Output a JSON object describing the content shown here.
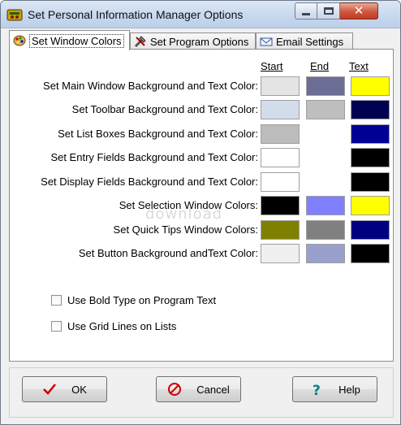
{
  "window": {
    "title": "Set Personal Information Manager Options",
    "controls": {
      "minimize": "minimize",
      "maximize": "maximize",
      "close": "close"
    }
  },
  "tabs": [
    {
      "label": "Set Window Colors",
      "icon": "palette-icon",
      "active": true
    },
    {
      "label": "Set Program Options",
      "icon": "tools-icon",
      "active": false
    },
    {
      "label": "Email Settings",
      "icon": "envelope-icon",
      "active": false
    }
  ],
  "columns": {
    "start": "Start",
    "end": "End",
    "text": "Text"
  },
  "color_rows": [
    {
      "label": "Set Main Window Background and Text Color:",
      "start": "#e4e4e4",
      "end": "#6c6e96",
      "text": "#ffff00"
    },
    {
      "label": "Set Toolbar Background and Text Color:",
      "start": "#d2dcea",
      "end": "#bebebe",
      "text": "#000050"
    },
    {
      "label": "Set List Boxes Background and Text Color:",
      "start": "#bcbcbc",
      "end": "",
      "text": "#000096"
    },
    {
      "label": "Set Entry Fields Background and Text Color:",
      "start": "#ffffff",
      "end": "",
      "text": "#000000"
    },
    {
      "label": "Set Display Fields Background and Text Color:",
      "start": "#ffffff",
      "end": "",
      "text": "#000000"
    },
    {
      "label": "Set Selection Window Colors:",
      "start": "#000000",
      "end": "#8080ff",
      "text": "#ffff00"
    },
    {
      "label": "Set Quick Tips Window Colors:",
      "start": "#808000",
      "end": "#808080",
      "text": "#000080"
    },
    {
      "label": "Set Button Background andText Color:",
      "start": "#f0f0f0",
      "end": "#9aa0cc",
      "text": "#000000"
    }
  ],
  "options": [
    {
      "label": "Use Bold Type on Program Text",
      "checked": false
    },
    {
      "label": "Use Grid Lines on Lists",
      "checked": false
    }
  ],
  "buttons": {
    "ok": {
      "label": "OK",
      "icon": "checkmark-icon",
      "color": "#cc0000"
    },
    "cancel": {
      "label": "Cancel",
      "icon": "no-entry-icon",
      "color": "#cc0000"
    },
    "help": {
      "label": "Help",
      "icon": "question-icon",
      "color": "#008080"
    }
  },
  "watermark": "download"
}
